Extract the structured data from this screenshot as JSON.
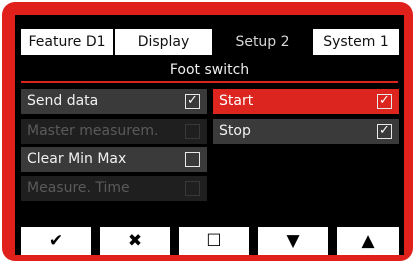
{
  "tabs": [
    "Feature  D1",
    "Display",
    "Setup 2",
    "System 1"
  ],
  "active_tab": "Setup 2",
  "subtitle": "Foot switch",
  "left_items": [
    {
      "label": "Send data",
      "checked": true,
      "enabled": true
    },
    {
      "label": "Master measurem.",
      "checked": false,
      "enabled": false
    },
    {
      "label": "Clear Min Max",
      "checked": false,
      "enabled": true
    },
    {
      "label": "Measure. Time",
      "checked": false,
      "enabled": false
    }
  ],
  "right_items": [
    {
      "label": "Start",
      "checked": true,
      "selected": true
    },
    {
      "label": "Stop",
      "checked": true,
      "selected": false
    }
  ],
  "softkeys": [
    {
      "name": "confirm",
      "symbol": "✔"
    },
    {
      "name": "cancel",
      "symbol": "✖"
    },
    {
      "name": "toggle",
      "symbol": "☐"
    },
    {
      "name": "down",
      "symbol": "▼"
    },
    {
      "name": "up",
      "symbol": "▲"
    }
  ],
  "colors": {
    "frame": "#e0201b",
    "selected": "#dc251f",
    "item": "#3a3a3a",
    "item_disabled": "#1f1f1f"
  },
  "check_glyph": "✓"
}
